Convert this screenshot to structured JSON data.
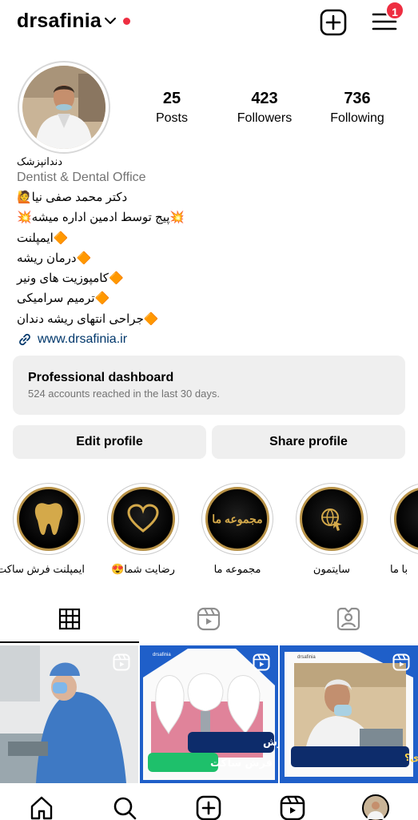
{
  "header": {
    "username": "drsafinia",
    "notification_count": "1"
  },
  "profile": {
    "stats": [
      {
        "value": "25",
        "label": "Posts"
      },
      {
        "value": "423",
        "label": "Followers"
      },
      {
        "value": "736",
        "label": "Following"
      }
    ],
    "name": "دندانپزشک",
    "category": "Dentist & Dental Office",
    "bio_lines": [
      "دکتر محمد صفی نیا🙋",
      "💥پیج توسط ادمین اداره میشه💥",
      "🔶ایمپلنت",
      "🔶درمان ریشه",
      "🔶کامپوزیت های ونیر",
      "🔶ترمیم سرامیکی",
      "🔶جراحی انتهای ریشه دندان"
    ],
    "website": "www.drsafinia.ir"
  },
  "dashboard": {
    "title": "Professional dashboard",
    "subtitle": "524 accounts reached in the last 30 days."
  },
  "buttons": {
    "edit": "Edit profile",
    "share": "Share profile"
  },
  "highlights": [
    {
      "label": "ایمپلنت فرش ساکت",
      "icon": "tooth-icon"
    },
    {
      "label": "رضایت شما😍",
      "icon": "heart-icon"
    },
    {
      "label": "مجموعه ما",
      "text": "مجموعه ما"
    },
    {
      "label": "سایتمون",
      "icon": "globe-icon"
    },
    {
      "label": "با ما",
      "icon": "partial-icon"
    }
  ],
  "posts": [
    {
      "caption": ""
    },
    {
      "watermark": "drsafinia",
      "caption1": "ایمپلنت به روش",
      "caption2": "فرش ساکت"
    },
    {
      "watermark": "drsafinia",
      "caption1": "به ابزار کارت اهمیت میدی؟"
    }
  ],
  "colors": {
    "accent_red": "#ee2e41",
    "link_blue": "#00376b",
    "muted": "#737373",
    "gold": "#b89247",
    "post_blue": "#1f5fc9"
  }
}
